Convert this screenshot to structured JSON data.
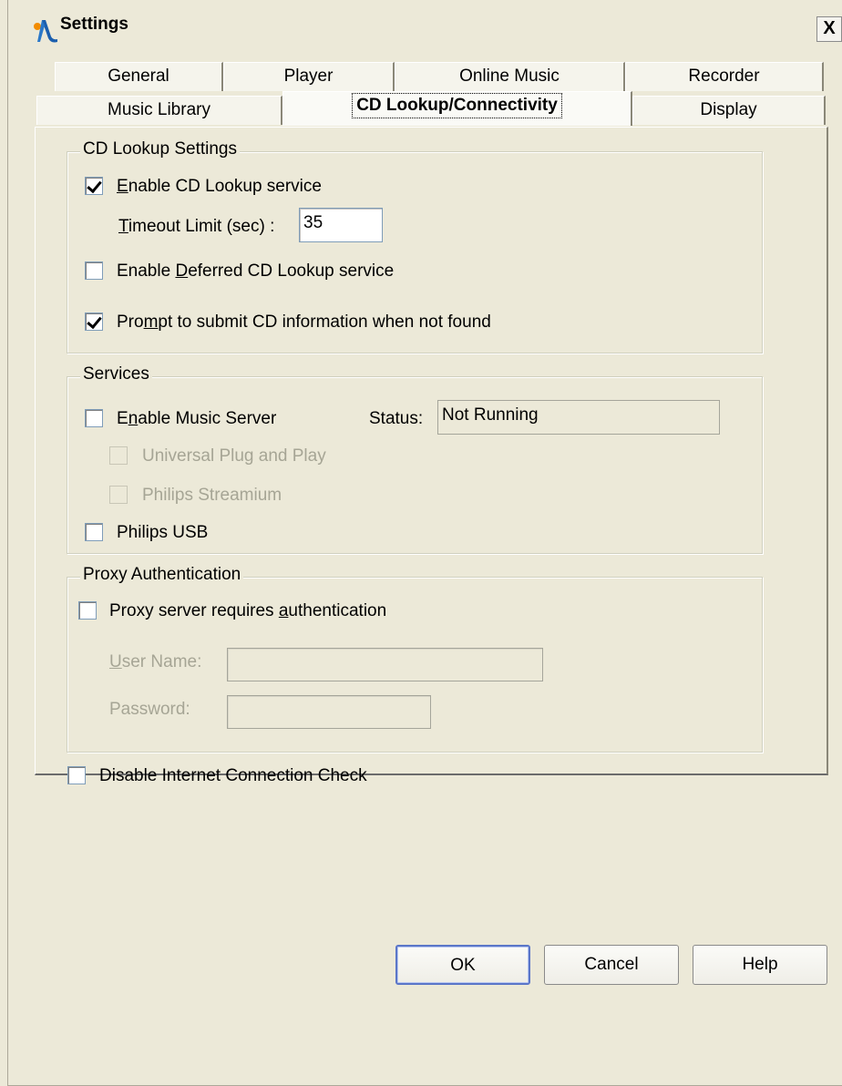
{
  "window": {
    "title": "Settings",
    "close_label": "X"
  },
  "tabs_row1": [
    {
      "label": "General"
    },
    {
      "label": "Player"
    },
    {
      "label": "Online Music"
    },
    {
      "label": "Recorder"
    }
  ],
  "tabs_row2": [
    {
      "label": "Music Library"
    },
    {
      "label": "CD Lookup/Connectivity",
      "active": true
    },
    {
      "label": "Display"
    }
  ],
  "cd_lookup": {
    "legend": "CD Lookup Settings",
    "enable_lookup": {
      "label_pre": "",
      "label_ul": "E",
      "label_post": "nable CD Lookup service",
      "checked": true
    },
    "timeout": {
      "label_ul": "T",
      "label_post": "imeout Limit (sec) :",
      "value": "35"
    },
    "deferred": {
      "label_pre": "Enable ",
      "label_ul": "D",
      "label_post": "eferred CD Lookup service",
      "checked": false
    },
    "prompt": {
      "label_pre": "Pro",
      "label_ul": "m",
      "label_post": "pt to submit CD information when not found",
      "checked": true
    }
  },
  "services": {
    "legend": "Services",
    "music_server": {
      "label_pre": "E",
      "label_ul": "n",
      "label_post": "able Music Server",
      "checked": false
    },
    "status_label": "Status:",
    "status_value": "Not Running",
    "upnp": {
      "label": "Universal Plug and Play",
      "checked": false,
      "disabled": true
    },
    "streamium": {
      "label": "Philips Streamium",
      "checked": false,
      "disabled": true
    },
    "usb": {
      "label": "Philips USB",
      "checked": false
    }
  },
  "proxy": {
    "legend": "Proxy Authentication",
    "requires_auth": {
      "label_pre": "Proxy server requires ",
      "label_ul": "a",
      "label_post": "uthentication",
      "checked": false
    },
    "username": {
      "label_ul": "U",
      "label_post": "ser Name:",
      "value": ""
    },
    "password": {
      "label": "Password:",
      "value": ""
    }
  },
  "disable_check": {
    "label": "Disable Internet Connection Check",
    "checked": false
  },
  "buttons": {
    "ok": "OK",
    "cancel": "Cancel",
    "help": "Help"
  }
}
